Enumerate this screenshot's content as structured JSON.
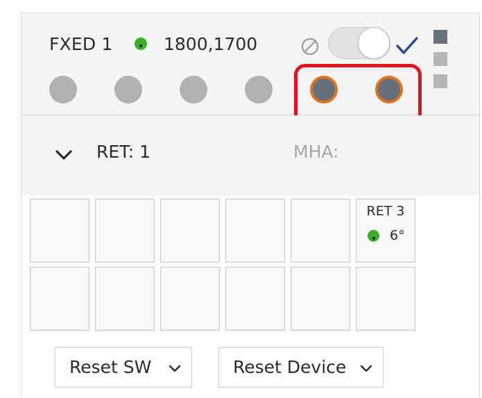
{
  "header": {
    "title": "FXED 1",
    "status_color": "#3dae2b",
    "frequencies": "1800,1700",
    "toggle_on": true,
    "ports": [
      {
        "state": "inactive"
      },
      {
        "state": "inactive"
      },
      {
        "state": "inactive"
      },
      {
        "state": "inactive"
      },
      {
        "state": "active"
      },
      {
        "state": "active"
      }
    ],
    "side_indicator_colors": [
      "#6a7078",
      "#b5b5b5",
      "#b5b5b5"
    ],
    "active_port_colors": {
      "fill": "#65707c",
      "ring": "#e0741e"
    },
    "highlight_color": "#e1131f",
    "icons": [
      "disabled-icon",
      "check-icon"
    ]
  },
  "ret_bar": {
    "ret_label": "RET: 1",
    "mha_label": "MHA:",
    "icon": "chevron-down-icon"
  },
  "ret_grid": {
    "rows": [
      [
        {
          "title": "",
          "tilt": ""
        },
        {
          "title": "",
          "tilt": ""
        },
        {
          "title": "",
          "tilt": ""
        },
        {
          "title": "",
          "tilt": ""
        },
        {
          "title": "",
          "tilt": ""
        },
        {
          "title": "RET 3",
          "tilt": "6°",
          "status_color": "#3dae2b"
        }
      ],
      [
        {
          "title": "",
          "tilt": ""
        },
        {
          "title": "",
          "tilt": ""
        },
        {
          "title": "",
          "tilt": ""
        },
        {
          "title": "",
          "tilt": ""
        },
        {
          "title": "",
          "tilt": ""
        },
        {
          "title": "",
          "tilt": ""
        }
      ]
    ]
  },
  "actions": {
    "reset_sw_label": "Reset SW",
    "reset_device_label": "Reset Device"
  }
}
